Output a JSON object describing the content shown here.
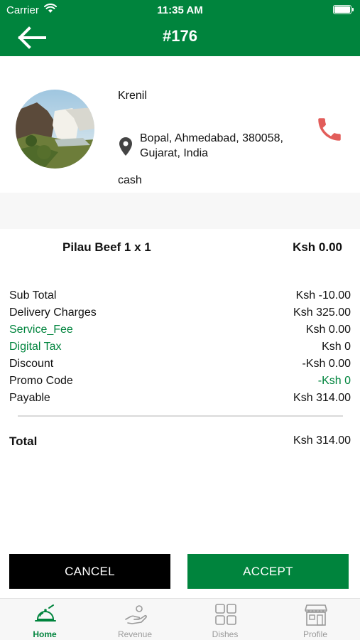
{
  "status_bar": {
    "carrier": "Carrier",
    "time": "11:35 AM"
  },
  "header": {
    "title": "#176",
    "back_icon": "arrow-left-icon"
  },
  "customer": {
    "name": "Krenil",
    "address": "Bopal, Ahmedabad, 380058, Gujarat, India",
    "payment_method": "cash",
    "location_icon": "map-pin-icon",
    "phone_icon": "phone-icon"
  },
  "order_item": {
    "name": "Pilau Beef 1 x 1",
    "price": "Ksh 0.00"
  },
  "summary": [
    {
      "label": "Sub Total",
      "value": "Ksh -10.00"
    },
    {
      "label": "Delivery Charges",
      "value": "Ksh 325.00"
    },
    {
      "label": "Service_Fee",
      "value": "Ksh 0.00"
    },
    {
      "label": "Digital Tax",
      "value": "Ksh 0"
    },
    {
      "label": "Discount",
      "value": "-Ksh 0.00"
    },
    {
      "label": "Promo Code",
      "value": "-Ksh 0"
    },
    {
      "label": "Payable",
      "value": "Ksh 314.00"
    }
  ],
  "total": {
    "label": "Total",
    "value": "Ksh 314.00"
  },
  "actions": {
    "cancel": "CANCEL",
    "accept": "ACCEPT"
  },
  "tabs": [
    {
      "label": "Home",
      "icon": "food-tray-icon",
      "active": true
    },
    {
      "label": "Revenue",
      "icon": "hand-coin-icon",
      "active": false
    },
    {
      "label": "Dishes",
      "icon": "grid-icon",
      "active": false
    },
    {
      "label": "Profile",
      "icon": "store-icon",
      "active": false
    }
  ],
  "colors": {
    "brand_green": "#00843d",
    "phone_red": "#e25d5a",
    "cancel_black": "#000000"
  }
}
